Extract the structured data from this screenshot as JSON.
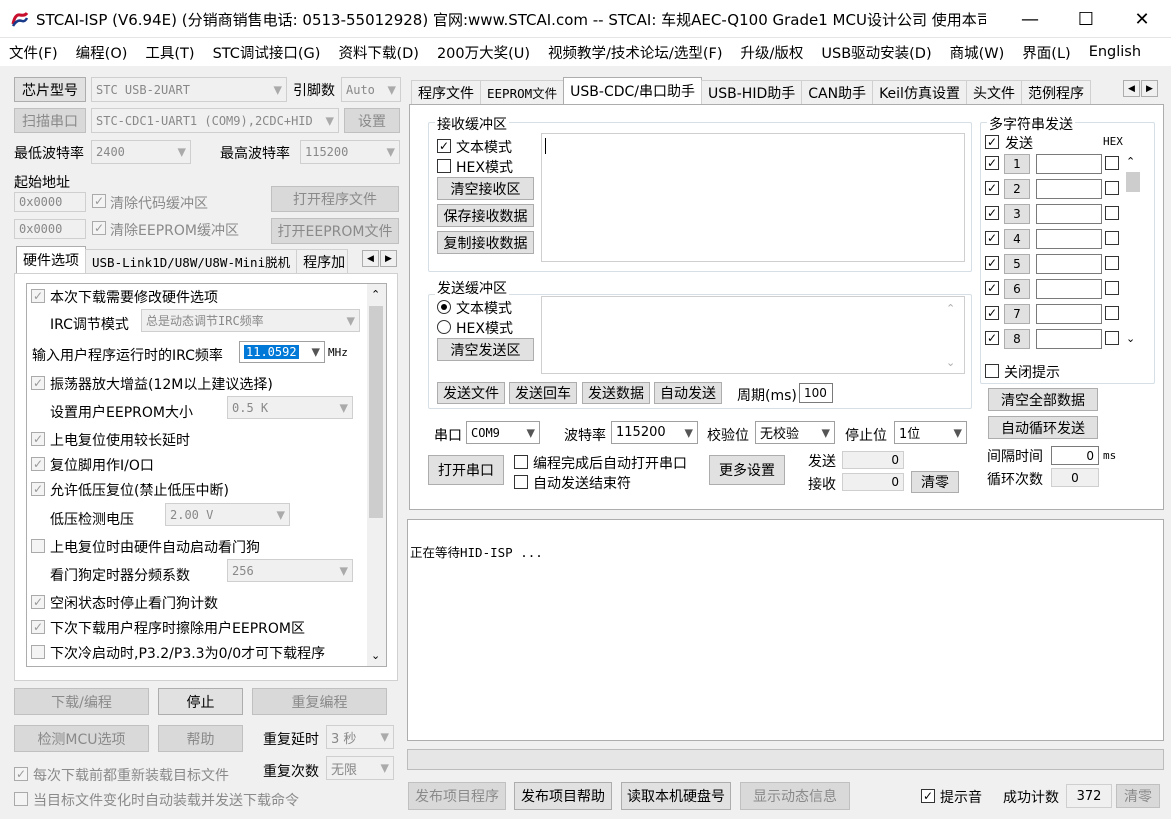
{
  "window": {
    "title": "STCAI-ISP (V6.94E) (分销商销售电话: 0513-55012928) 官网:www.STCAI.com  -- STCAI: 车规AEC-Q100 Grade1 MCU设计公司 使用本司...",
    "minimize": "—",
    "maximize": "☐",
    "close": "✕"
  },
  "menu": [
    "文件(F)",
    "编程(O)",
    "工具(T)",
    "STC调试接口(G)",
    "资料下载(D)",
    "200万大奖(U)",
    "视频教学/技术论坛/选型(F)",
    "升级/版权",
    "USB驱动安装(D)",
    "商城(W)",
    "界面(L)",
    "English"
  ],
  "left": {
    "chip_btn": "芯片型号",
    "chip_value": "STC USB-2UART",
    "pin_label": "引脚数",
    "pin_value": "Auto",
    "scan_btn": "扫描串口",
    "port_value": "STC-CDC1-UART1 (COM9),2CDC+HID",
    "settings_btn": "设置",
    "min_baud_label": "最低波特率",
    "min_baud": "2400",
    "max_baud_label": "最高波特率",
    "max_baud": "115200",
    "start_addr_label": "起始地址",
    "addr1": "0x0000",
    "clear_code": "清除代码缓冲区",
    "open_prog": "打开程序文件",
    "addr2": "0x0000",
    "clear_eeprom": "清除EEPROM缓冲区",
    "open_eeprom": "打开EEPROM文件",
    "tabs": [
      "硬件选项",
      "USB-Link1D/U8W/U8W-Mini脱机",
      "程序加"
    ],
    "options": {
      "opt1": "本次下载需要修改硬件选项",
      "irc_mode_label": "IRC调节模式",
      "irc_mode": "总是动态调节IRC频率",
      "irc_freq_label": "输入用户程序运行时的IRC频率",
      "irc_freq": "11.0592",
      "mhz": "MHz",
      "opt2": "振荡器放大增益(12M以上建议选择)",
      "eeprom_size_label": "设置用户EEPROM大小",
      "eeprom_size": "0.5 K",
      "opt3": "上电复位使用较长延时",
      "opt4": "复位脚用作I/O口",
      "opt5": "允许低压复位(禁止低压中断)",
      "lvd_label": "低压检测电压",
      "lvd": "2.00 V",
      "opt6": "上电复位时由硬件自动启动看门狗",
      "wdt_label": "看门狗定时器分频系数",
      "wdt": "256",
      "opt7": "空闲状态时停止看门狗计数",
      "opt8": "下次下载用户程序时擦除用户EEPROM区",
      "opt9": "下次冷启动时,P3.2/P3.3为0/0才可下载程序"
    },
    "download_btn": "下载/编程",
    "stop_btn": "停止",
    "reprog_btn": "重复编程",
    "detect_btn": "检测MCU选项",
    "help_btn": "帮助",
    "delay_label": "重复延时",
    "delay": "3 秒",
    "count_label": "重复次数",
    "count": "无限",
    "reload_cb": "每次下载前都重新装载目标文件",
    "auto_cb": "当目标文件变化时自动装载并发送下载命令"
  },
  "right": {
    "tabs": [
      "程序文件",
      "EEPROM文件",
      "USB-CDC/串口助手",
      "USB-HID助手",
      "CAN助手",
      "Keil仿真设置",
      "头文件",
      "范例程序"
    ],
    "recv_group": "接收缓冲区",
    "recv_text_mode": "文本模式",
    "recv_hex_mode": "HEX模式",
    "clear_recv": "清空接收区",
    "save_recv": "保存接收数据",
    "copy_recv": "复制接收数据",
    "send_group": "发送缓冲区",
    "send_text_mode": "文本模式",
    "send_hex_mode": "HEX模式",
    "clear_send": "清空发送区",
    "send_file": "发送文件",
    "send_enter": "发送回车",
    "send_data": "发送数据",
    "auto_send": "自动发送",
    "period_label": "周期(ms)",
    "period": "100",
    "port_label": "串口",
    "port": "COM9",
    "baud_label": "波特率",
    "baud": "115200",
    "parity_label": "校验位",
    "parity": "无校验",
    "stop_label": "停止位",
    "stop": "1位",
    "open_port": "打开串口",
    "auto_open": "编程完成后自动打开串口",
    "auto_end": "自动发送结束符",
    "more_settings": "更多设置",
    "send_count_label": "发送",
    "send_count": "0",
    "recv_count_label": "接收",
    "recv_count": "0",
    "clear_count": "清零",
    "multi_group": "多字符串发送",
    "multi_send": "发送",
    "hex": "HEX",
    "rows": [
      "1",
      "2",
      "3",
      "4",
      "5",
      "6",
      "7",
      "8"
    ],
    "close_tip": "关闭提示",
    "clear_all": "清空全部数据",
    "auto_loop": "自动循环发送",
    "interval_label": "间隔时间",
    "interval": "0",
    "ms": "ms",
    "loop_label": "循环次数",
    "loop": "0"
  },
  "log": {
    "text": "正在等待HID-ISP ..."
  },
  "bottom": {
    "publish_prog": "发布项目程序",
    "publish_help": "发布项目帮助",
    "read_disk": "读取本机硬盘号",
    "show_info": "显示动态信息",
    "sound_cb": "提示音",
    "success_label": "成功计数",
    "success": "372",
    "clear": "清零"
  }
}
